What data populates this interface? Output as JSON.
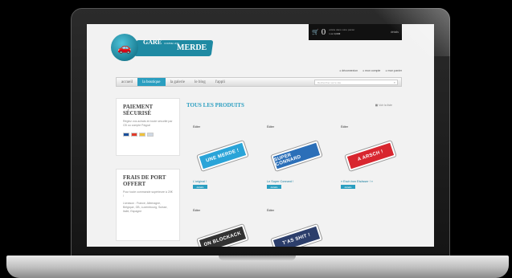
{
  "cart": {
    "count": "0",
    "line1": "article dans votre panier",
    "line2_label": "total",
    "amount": "0,00€",
    "detail_label": "détails"
  },
  "logo": {
    "line1": "GARÉ",
    "small": "COMME UNE",
    "line2": "MERDE"
  },
  "account_links": [
    "déconnexion",
    "mon compte",
    "mon panier"
  ],
  "nav": {
    "items": [
      "accueil",
      "la boutique",
      "la galerie",
      "le blog",
      "l'appli"
    ],
    "active_index": 1,
    "search_placeholder": "Rechercher sur le site"
  },
  "sidebar": {
    "payment": {
      "title": "PAIEMENT SÉCURISÉ",
      "text": "Réglez vos achats en toute sécurité par CB ou compte Paypal"
    },
    "shipping": {
      "title": "FRAIS DE PORT OFFERT",
      "text1": "Pour toute commande supérieure à 20€ !",
      "text2": "Livraison : France, Allemagne, Belgique, GB, Luxembourg, Suisse, Italie, Espagne"
    }
  },
  "main": {
    "title": "TOUS LES PRODUITS",
    "view_label": "Voir la liste"
  },
  "products": [
    {
      "edit": "Éditer",
      "name": "L'original !",
      "button": "détails",
      "sticker": "UNE MERDE !",
      "color": "#2aa4d8"
    },
    {
      "edit": "Éditer",
      "name": "Le Super Connard !",
      "button": "détails",
      "sticker": "SUPER CONNARD",
      "color": "#2b6fb8"
    },
    {
      "edit": "Éditer",
      "name": "« Esch bon Elsässer ! »",
      "button": "détails",
      "sticker": "A ARSCH !",
      "color": "#d8262f"
    },
    {
      "edit": "Éditer",
      "name": "",
      "button": "",
      "sticker": "ON BLOCKACK",
      "color": "#333333"
    },
    {
      "edit": "Éditer",
      "name": "",
      "button": "",
      "sticker": "T'AS SHIT !",
      "color": "#2c3e6b"
    }
  ],
  "colors": {
    "accent": "#2a9ec0",
    "nav_bg": "#e8e8e8"
  }
}
